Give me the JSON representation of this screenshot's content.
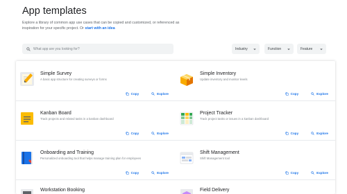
{
  "header": {
    "title": "App templates",
    "description": "Explore a library of common app use cases that can be copied and customized, or referenced as inspiration for your specific project. Or",
    "link_label": "start with an idea"
  },
  "search": {
    "placeholder": "What app are you looking for?",
    "icon": "search-icon"
  },
  "filters": [
    {
      "label": "Industry"
    },
    {
      "label": "Function"
    },
    {
      "label": "Feature"
    }
  ],
  "actions": {
    "copy": "Copy",
    "explore": "Explore"
  },
  "templates": [
    {
      "title": "Simple Survey",
      "description": "A basic app structure for creating surveys or forms",
      "icon": "notepad-pencil-icon"
    },
    {
      "title": "Simple Inventory",
      "description": "Update inventory and monitor levels",
      "icon": "box-icon"
    },
    {
      "title": "Kanban Board",
      "description": "Track projects and related tasks in a kanban dashboard",
      "icon": "sticky-note-icon"
    },
    {
      "title": "Project Tracker",
      "description": "Track project tasks or issues in a kanban dashboard",
      "icon": "spreadsheet-icon"
    },
    {
      "title": "Onboarding and Training",
      "description": "Personalized onboarding tool that helps manage training plan for employees",
      "icon": "book-icon"
    },
    {
      "title": "Shift Management",
      "description": "Shift Management tool",
      "icon": "calendar-icon"
    },
    {
      "title": "Workstation Booking",
      "description": "",
      "icon": "desk-icon"
    },
    {
      "title": "Field Delivery",
      "description": "",
      "icon": "delivery-box-icon"
    }
  ],
  "colors": {
    "accent": "#1a73e8",
    "title": "#202124",
    "muted": "#80868b",
    "field_bg": "#f1f3f4"
  }
}
